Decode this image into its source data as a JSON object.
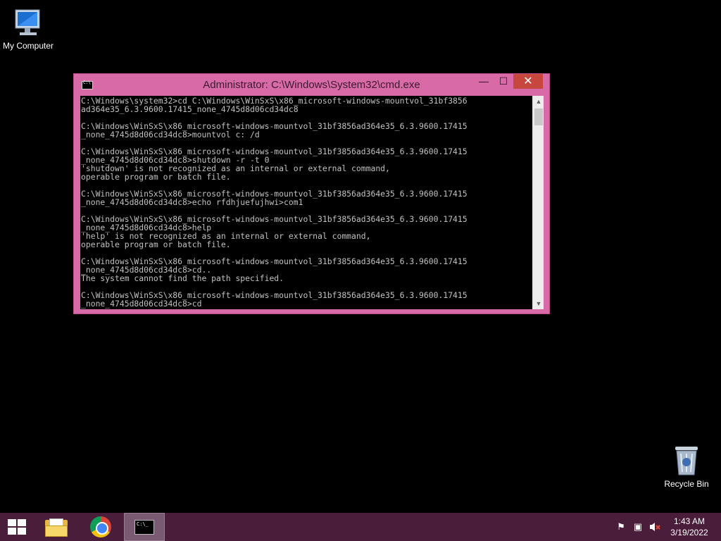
{
  "desktop": {
    "icons": [
      {
        "label": "My Computer",
        "icon": "computer-icon"
      },
      {
        "label": "Recycle Bin",
        "icon": "recycle-bin-icon"
      }
    ]
  },
  "window": {
    "title": "Administrator: C:\\Windows\\System32\\cmd.exe",
    "controls": {
      "minimize": "—",
      "maximize": "☐",
      "close": "✕"
    },
    "console_text": "C:\\Windows\\system32>cd C:\\Windows\\WinSxS\\x86_microsoft-windows-mountvol_31bf3856\nad364e35_6.3.9600.17415_none_4745d8d06cd34dc8\n\nC:\\Windows\\WinSxS\\x86_microsoft-windows-mountvol_31bf3856ad364e35_6.3.9600.17415\n_none_4745d8d06cd34dc8>mountvol c: /d\n\nC:\\Windows\\WinSxS\\x86_microsoft-windows-mountvol_31bf3856ad364e35_6.3.9600.17415\n_none_4745d8d06cd34dc8>shutdown -r -t 0\n'shutdown' is not recognized as an internal or external command,\noperable program or batch file.\n\nC:\\Windows\\WinSxS\\x86_microsoft-windows-mountvol_31bf3856ad364e35_6.3.9600.17415\n_none_4745d8d06cd34dc8>echo rfdhjuefujhwi>com1\n\nC:\\Windows\\WinSxS\\x86_microsoft-windows-mountvol_31bf3856ad364e35_6.3.9600.17415\n_none_4745d8d06cd34dc8>help\n'help' is not recognized as an internal or external command,\noperable program or batch file.\n\nC:\\Windows\\WinSxS\\x86_microsoft-windows-mountvol_31bf3856ad364e35_6.3.9600.17415\n_none_4745d8d06cd34dc8>cd..\nThe system cannot find the path specified.\n\nC:\\Windows\\WinSxS\\x86_microsoft-windows-mountvol_31bf3856ad364e35_6.3.9600.17415\n_none_4745d8d06cd34dc8>cd",
    "scroll": {
      "up": "▲",
      "down": "▼"
    }
  },
  "taskbar": {
    "buttons": [
      "start-icon",
      "file-explorer-icon",
      "chrome-icon",
      "command-prompt-icon"
    ],
    "tray": {
      "flag": "⚑",
      "network": "▣",
      "volume": "🔈"
    },
    "clock": {
      "time": "1:43 AM",
      "date": "3/19/2022"
    }
  },
  "colors": {
    "window_frame": "#d96aa8",
    "close_button": "#c7463e",
    "taskbar": "#4a1e3b",
    "console_bg": "#000000",
    "console_fg": "#c0c0c0"
  }
}
